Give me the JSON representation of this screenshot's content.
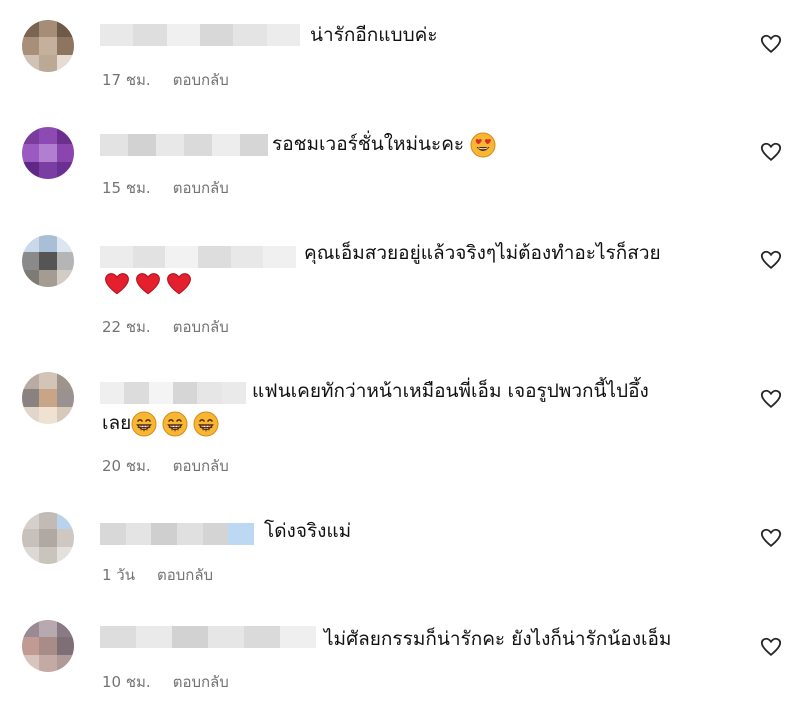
{
  "comments": [
    {
      "text": "น่ารักอีกแบบค่ะ",
      "time": "17 ชม.",
      "reply": "ตอบกลับ",
      "avatar_colors": [
        "#7a6552",
        "#a58d78",
        "#6e5a48",
        "#a88f7a",
        "#c4b09c",
        "#8d7561",
        "#d0c2b4",
        "#bba996",
        "#e6dcd1"
      ],
      "username_blocks": [
        "#e9e9e9",
        "#dedede",
        "#f0f0f0",
        "#d8d8d8",
        "#e4e4e4",
        "#ececec"
      ]
    },
    {
      "text": "รอชมเวอร์ชั่นใหม่นะคะ",
      "emoji": "heart-eyes",
      "time": "15 ชม.",
      "reply": "ตอบกลับ",
      "avatar_colors": [
        "#7a3d9e",
        "#8c4ab2",
        "#6b2f8f",
        "#9a5ac2",
        "#b27ed0",
        "#8a46ae",
        "#5f2788",
        "#7a3da2",
        "#6a2f92"
      ],
      "username_blocks": [
        "#e3e3e3",
        "#d2d2d2",
        "#e8e8e8",
        "#dadada",
        "#ededed",
        "#d6d6d6"
      ]
    },
    {
      "text_lines": [
        "คุณเอ็มสวยอยู่แล้วจริงๆไม่ต้องทำอะไรก็สวย"
      ],
      "emoji": "red-heart",
      "emoji_count": 3,
      "time": "22 ชม.",
      "reply": "ตอบกลับ",
      "avatar_colors": [
        "#c9d9ea",
        "#a9bfd6",
        "#dbe6f0",
        "#8a8a8a",
        "#555555",
        "#b5b5b5",
        "#7e7a74",
        "#a49c92",
        "#d2ccc4"
      ],
      "username_blocks": [
        "#ececec",
        "#e2e2e2",
        "#f2f2f2",
        "#dddddd",
        "#e8e8e8",
        "#f0f0f0"
      ]
    },
    {
      "text_lines": [
        "แฟนเคยทักว่าหน้าเหมือนพี่เอ็ม เจอรูปพวกนี้ไปอึ้ง",
        "เลย"
      ],
      "emoji": "grinning-face",
      "emoji_count": 3,
      "time": "20 ชม.",
      "reply": "ตอบกลับ",
      "avatar_colors": [
        "#b8aca2",
        "#d2c4b6",
        "#9e948a",
        "#8a8280",
        "#c8a488",
        "#9a9290",
        "#e2d6ca",
        "#f0e2d2",
        "#d8cabb"
      ],
      "username_blocks": [
        "#efefef",
        "#dcdcdc",
        "#f4f4f4",
        "#d6d6d6",
        "#e6e6e6",
        "#eaeaea"
      ]
    },
    {
      "text": "โด่งจริงแม่",
      "time": "1 วัน",
      "reply": "ตอบกลับ",
      "avatar_colors": [
        "#d6d0cc",
        "#c2bab4",
        "#b8d4ec",
        "#c8c0ba",
        "#b0a8a2",
        "#cfc8c2",
        "#ddd8d4",
        "#cac4be",
        "#e4e0dc"
      ],
      "username_blocks": [
        "#d8d8d8",
        "#e4e4e4",
        "#cfcfcf",
        "#e0e0e0",
        "#d4d4d4",
        "#bcd8f2"
      ]
    },
    {
      "text": "ไม่ศัลยกรรมก็น่ารักคะ ยังไงก็น่ารักน้องเอ็ม",
      "time": "10 ชม.",
      "reply": "ตอบกลับ",
      "avatar_colors": [
        "#9a8a94",
        "#b8a8b0",
        "#8a7a86",
        "#c29a94",
        "#a88c88",
        "#7e6e76",
        "#d8c4be",
        "#c4aaa4",
        "#b09a98"
      ],
      "username_blocks": [
        "#dddddd",
        "#eaeaea",
        "#d2d2d2",
        "#e6e6e6",
        "#dadada",
        "#efefef"
      ]
    }
  ],
  "colors": {
    "meta": "#737373",
    "text": "#111111",
    "heart_stroke": "#262626"
  }
}
